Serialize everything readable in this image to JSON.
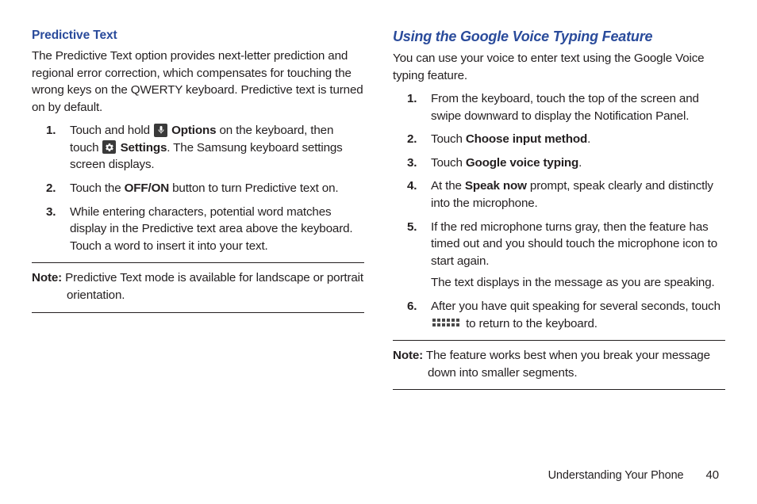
{
  "left": {
    "heading": "Predictive Text",
    "intro": "The Predictive Text option provides next-letter prediction and regional error correction, which compensates for touching the wrong keys on the QWERTY keyboard. Predictive text is turned on by default.",
    "steps": {
      "s1a": "Touch and hold ",
      "s1b_bold": "Options",
      "s1c": " on the keyboard, then touch ",
      "s1d_bold": "Settings",
      "s1e": ". The Samsung keyboard settings screen displays.",
      "s2a": "Touch the ",
      "s2b_bold": "OFF/ON",
      "s2c": " button to turn Predictive text on.",
      "s3": "While entering characters, potential word matches display in the Predictive text area above the keyboard. Touch a word to insert it into your text."
    },
    "note_label": "Note:",
    "note_text": " Predictive Text mode is available for landscape or portrait orientation."
  },
  "right": {
    "heading": "Using the Google Voice Typing Feature",
    "intro": "You can use your voice to enter text using the Google Voice typing feature.",
    "steps": {
      "s1": "From the keyboard, touch the top of the screen and swipe downward to display the Notification Panel.",
      "s2a": "Touch ",
      "s2b_bold": "Choose input method",
      "s2c": ".",
      "s3a": "Touch ",
      "s3b_bold": "Google voice typing",
      "s3c": ".",
      "s4a": "At the ",
      "s4b_bold": "Speak now",
      "s4c": " prompt, speak clearly and distinctly into the microphone.",
      "s5": "If the red microphone turns gray, then the feature has timed out and you should touch the microphone icon to start again.",
      "s5b": "The text displays in the message as you are speaking.",
      "s6a": "After you have quit speaking for several seconds, touch ",
      "s6b": " to return to the keyboard."
    },
    "note_label": "Note:",
    "note_text": " The feature works best when you break your message down into smaller segments."
  },
  "footer": {
    "section": "Understanding Your Phone",
    "page": "40"
  }
}
